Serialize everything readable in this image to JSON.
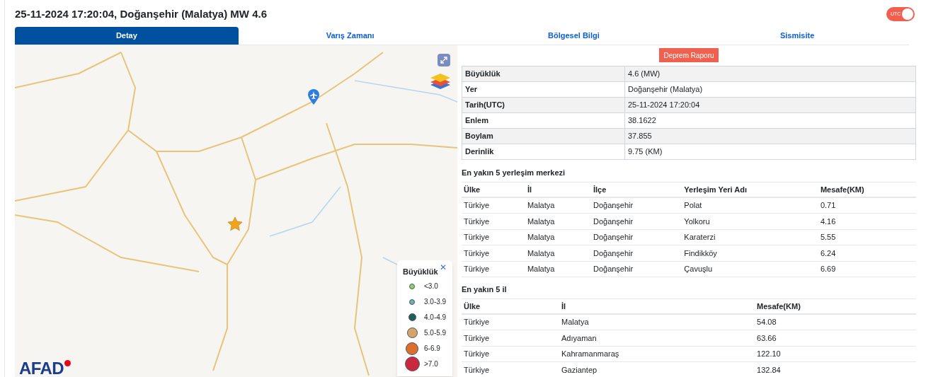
{
  "title": "25-11-2024 17:20:04, Doğanşehir (Malatya) MW 4.6",
  "utc_toggle": {
    "label": "UTC",
    "on": true
  },
  "tabs": [
    {
      "label": "Detay",
      "selected": true
    },
    {
      "label": "Varış Zamanı",
      "selected": false
    },
    {
      "label": "Bölgesel Bilgi",
      "selected": false
    },
    {
      "label": "Sismisite",
      "selected": false
    }
  ],
  "map": {
    "logo": "AFAD",
    "legend": {
      "title": "Büyüklük",
      "close": "✕",
      "items": [
        {
          "label": "<3.0",
          "color": "#8fd16b"
        },
        {
          "label": "3.0-3.9",
          "color": "#6fb3b0"
        },
        {
          "label": "4.0-4.9",
          "color": "#1f5f55"
        },
        {
          "label": "5.0-5.9",
          "color": "#d6a46a"
        },
        {
          "label": "6-6.9",
          "color": "#dd6f2c"
        },
        {
          "label": ">7.0",
          "color": "#c9283e"
        }
      ]
    }
  },
  "report_button": "Deprem Raporu",
  "details": [
    {
      "label": "Büyüklük",
      "value": "4.6 (MW)"
    },
    {
      "label": "Yer",
      "value": "Doğanşehir (Malatya)"
    },
    {
      "label": "Tarih(UTC)",
      "value": "25-11-2024 17:20:04"
    },
    {
      "label": "Enlem",
      "value": "38.1622"
    },
    {
      "label": "Boylam",
      "value": "37.855"
    },
    {
      "label": "Derinlik",
      "value": "9.75 (KM)"
    }
  ],
  "settlements": {
    "heading": "En yakın 5 yerleşim merkezi",
    "columns": [
      "Ülke",
      "İl",
      "İlçe",
      "Yerleşim Yeri Adı",
      "Mesafe(KM)"
    ],
    "rows": [
      [
        "Türkiye",
        "Malatya",
        "Doğanşehir",
        "Polat",
        "0.71"
      ],
      [
        "Türkiye",
        "Malatya",
        "Doğanşehir",
        "Yolkoru",
        "4.16"
      ],
      [
        "Türkiye",
        "Malatya",
        "Doğanşehir",
        "Karaterzi",
        "5.55"
      ],
      [
        "Türkiye",
        "Malatya",
        "Doğanşehir",
        "Findikköy",
        "6.24"
      ],
      [
        "Türkiye",
        "Malatya",
        "Doğanşehir",
        "Çavuşlu",
        "6.69"
      ]
    ]
  },
  "provinces": {
    "heading": "En yakın 5 il",
    "columns": [
      "Ülke",
      "İl",
      "Mesafe(KM)"
    ],
    "rows": [
      [
        "Türkiye",
        "Malatya",
        "54.08"
      ],
      [
        "Türkiye",
        "Adıyaman",
        "63.66"
      ],
      [
        "Türkiye",
        "Kahramanmaraş",
        "122.10"
      ],
      [
        "Türkiye",
        "Gaziantep",
        "132.84"
      ]
    ]
  }
}
